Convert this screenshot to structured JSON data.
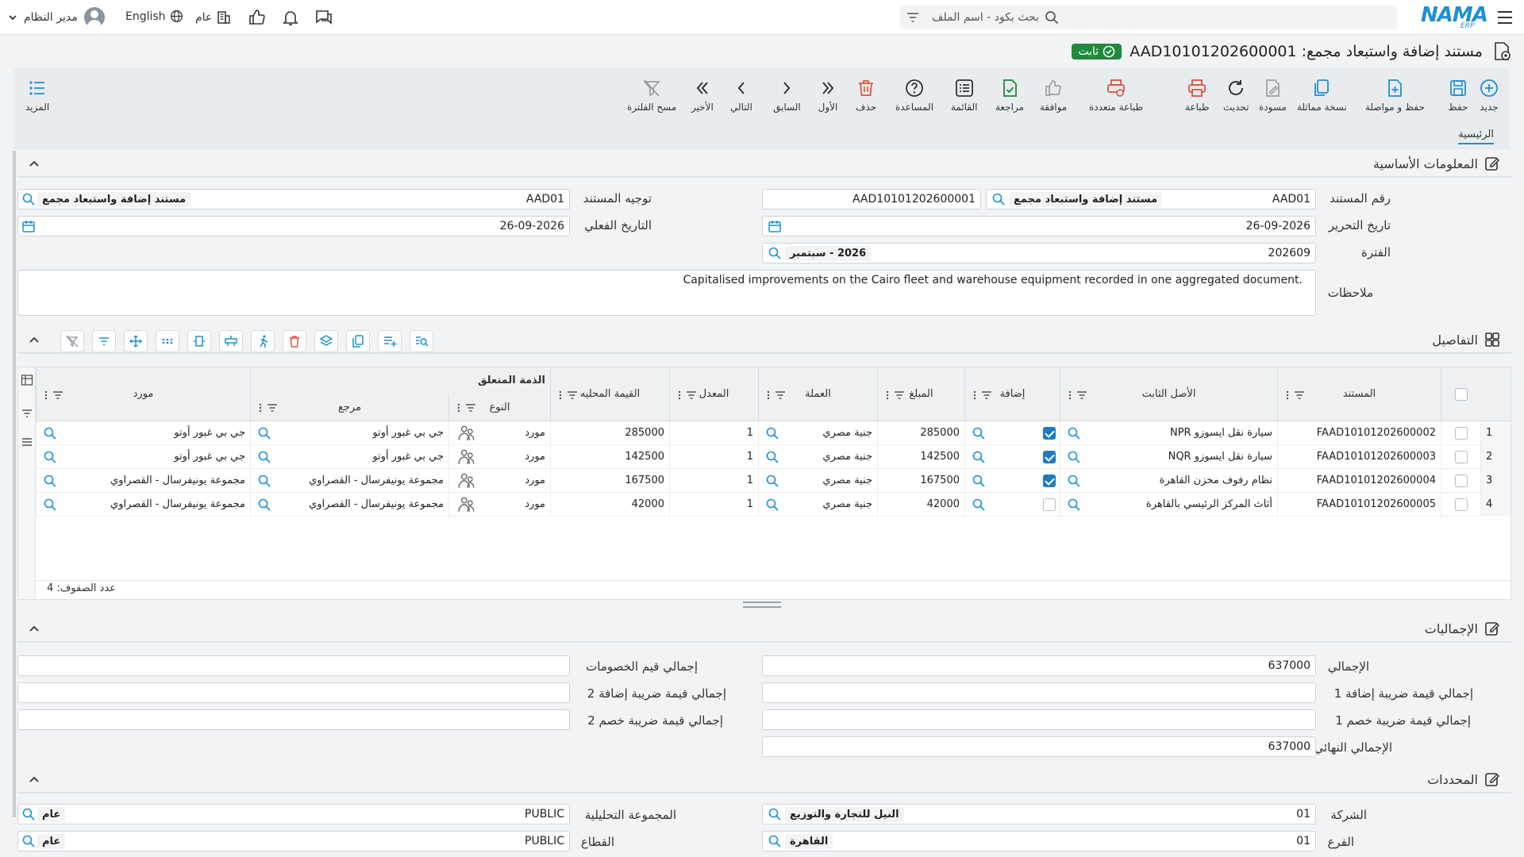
{
  "header": {
    "user": "مدير النظام",
    "language": "English",
    "workspace": "عام",
    "search_placeholder": "بحث بكود - اسم الملف",
    "logo": "NAMA",
    "logo_sub": "ERP"
  },
  "page": {
    "title": "مستند إضافة واستبعاد مجمع: AAD10101202600001",
    "status": "ثابت"
  },
  "toolbar": {
    "new": "جديد",
    "save": "حفظ",
    "save_continue": "حفظ و مواصلة",
    "duplicate": "نسخة مماثلة",
    "draft": "مسودة",
    "refresh": "تحديث",
    "print": "طباعة",
    "multi_print": "طباعة متعددة",
    "approve": "موافقة",
    "review": "مراجعة",
    "list": "القائمة",
    "help": "المساعدة",
    "delete": "حذف",
    "first": "الأول",
    "previous": "السابق",
    "next": "التالي",
    "last": "الأخير",
    "clear_filter": "مسح الفلترة",
    "more": "المزيد"
  },
  "tabs": {
    "main": "الرئيسية"
  },
  "basic_info": {
    "title": "المعلومات الأساسية",
    "doc_number_label": "رقم المستند",
    "doc_type_code": "AAD01",
    "doc_type_name": "مستند إضافة واستبعاد مجمع",
    "doc_number": "AAD10101202600001",
    "direction_label": "توجيه المستند",
    "direction_code": "AAD01",
    "direction_name": "مستند إضافة واستبعاد مجمع",
    "edit_date_label": "تاريخ التحرير",
    "edit_date": "26-09-2026",
    "actual_date_label": "التاريخ الفعلي",
    "actual_date": "26-09-2026",
    "period_label": "الفترة",
    "period_code": "202609",
    "period_name": "2026 - سبتمبر",
    "notes_label": "ملاحظات",
    "notes": "Capitalised improvements on the Cairo fleet and warehouse equipment recorded in one aggregated document."
  },
  "details": {
    "title": "التفاصيل",
    "columns": {
      "document": "المستند",
      "fixed_asset": "الأصل الثابت",
      "addition": "إضافة",
      "amount": "المبلغ",
      "currency": "العملة",
      "rate": "المعدل",
      "local_value": "القيمة المحليه",
      "related_liability": "الذمة المتعلق",
      "type": "النوع",
      "reference": "مرجع",
      "supplier": "مورد"
    },
    "rows": [
      {
        "n": "1",
        "document": "FAAD10101202600002",
        "asset": "سيارة نقل ايسوزو NPR",
        "amount": "285000",
        "currency": "جنية مصري",
        "rate": "1",
        "local": "285000",
        "type": "مورد",
        "reference": "جي بي غبور أوتو",
        "supplier": "جي بي غبور أوتو",
        "addition": true
      },
      {
        "n": "2",
        "document": "FAAD10101202600003",
        "asset": "سيارة نقل ايسوزو NQR",
        "amount": "142500",
        "currency": "جنية مصري",
        "rate": "1",
        "local": "142500",
        "type": "مورد",
        "reference": "جي بي غبور أوتو",
        "supplier": "جي بي غبور أوتو",
        "addition": true
      },
      {
        "n": "3",
        "document": "FAAD10101202600004",
        "asset": "نظام رفوف مخزن القاهرة",
        "amount": "167500",
        "currency": "جنية مصري",
        "rate": "1",
        "local": "167500",
        "type": "مورد",
        "reference": "مجموعة يونيفرسال - القصراوي",
        "supplier": "مجموعة يونيفرسال - القصراوي",
        "addition": true
      },
      {
        "n": "4",
        "document": "FAAD10101202600005",
        "asset": "أثاث المركز الرئيسي بالقاهرة",
        "amount": "42000",
        "currency": "جنية مصري",
        "rate": "1",
        "local": "42000",
        "type": "مورد",
        "reference": "مجموعة يونيفرسال - القصراوي",
        "supplier": "مجموعة يونيفرسال - القصراوي",
        "addition": false
      }
    ],
    "row_count": "عدد الصفوف: 4"
  },
  "totals": {
    "title": "الإجماليات",
    "total_label": "الإجمالي",
    "total": "637000",
    "discounts_label": "إجمالي قيم الخصومات",
    "add_tax1_label": "إجمالي قيمة ضريبة إضافة 1",
    "add_tax2_label": "إجمالي قيمة ضريبة إضافة 2",
    "disc_tax1_label": "إجمالي قيمة ضريبة خصم 1",
    "disc_tax2_label": "إجمالي قيمة ضريبة خصم 2",
    "final_label": "الإجمالي النهائي",
    "final": "637000"
  },
  "dimensions": {
    "title": "المحددات",
    "company_label": "الشركة",
    "company_code": "01",
    "company_name": "النيل للتجارة والتوزيع",
    "analysis_label": "المجموعة التحليلية",
    "analysis_code": "PUBLIC",
    "analysis_name": "عام",
    "branch_label": "الفرع",
    "branch_code": "01",
    "branch_name": "القاهرة",
    "sector_label": "القطاع",
    "sector_code": "PUBLIC",
    "sector_name": "عام"
  }
}
